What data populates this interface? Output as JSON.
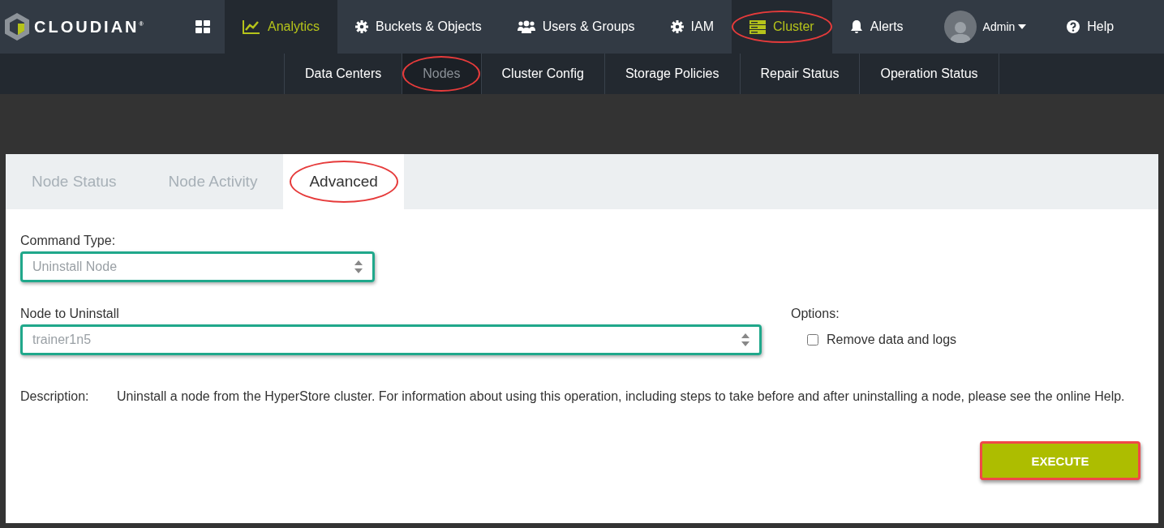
{
  "logo": {
    "text": "CLOUDIAN",
    "mark": "®"
  },
  "top_nav": [
    {
      "kind": "apps",
      "selected": false,
      "highlighted": false
    },
    {
      "kind": "chart",
      "label": "Analytics",
      "selected": true,
      "highlighted": false
    },
    {
      "kind": "gear",
      "label": "Buckets & Objects",
      "selected": false,
      "highlighted": false
    },
    {
      "kind": "users",
      "label": "Users & Groups",
      "selected": false,
      "highlighted": false
    },
    {
      "kind": "gear",
      "label": "IAM",
      "selected": false,
      "highlighted": false
    },
    {
      "kind": "server",
      "label": "Cluster",
      "selected": true,
      "highlighted": true
    },
    {
      "kind": "bell",
      "label": "Alerts",
      "selected": false,
      "highlighted": false
    },
    {
      "kind": "user",
      "label": "Admin",
      "selected": false,
      "highlighted": false
    },
    {
      "kind": "help",
      "label": "Help",
      "selected": false,
      "highlighted": false
    }
  ],
  "sub_nav": [
    {
      "label": "Data Centers",
      "selected": false,
      "highlighted": false
    },
    {
      "label": "Nodes",
      "selected": true,
      "highlighted": true
    },
    {
      "label": "Cluster Config",
      "selected": false,
      "highlighted": false
    },
    {
      "label": "Storage Policies",
      "selected": false,
      "highlighted": false
    },
    {
      "label": "Repair Status",
      "selected": false,
      "highlighted": false
    },
    {
      "label": "Operation Status",
      "selected": false,
      "highlighted": false
    }
  ],
  "tabs": [
    {
      "label": "Node Status",
      "selected": false,
      "highlighted": false
    },
    {
      "label": "Node Activity",
      "selected": false,
      "highlighted": false
    },
    {
      "label": "Advanced",
      "selected": true,
      "highlighted": true
    }
  ],
  "command_type": {
    "label": "Command Type:",
    "value": "Uninstall Node"
  },
  "node_to_uninstall": {
    "label": "Node to Uninstall",
    "value": "trainer1n5"
  },
  "options": {
    "label": "Options:",
    "items": [
      {
        "label": "Remove data and logs",
        "checked": false
      }
    ]
  },
  "description": {
    "label": "Description:",
    "text": "Uninstall a node from the HyperStore cluster. For information about using this operation, including steps to take before and after uninstalling a node, please see the online Help."
  },
  "execute_button": {
    "label": "EXECUTE"
  }
}
